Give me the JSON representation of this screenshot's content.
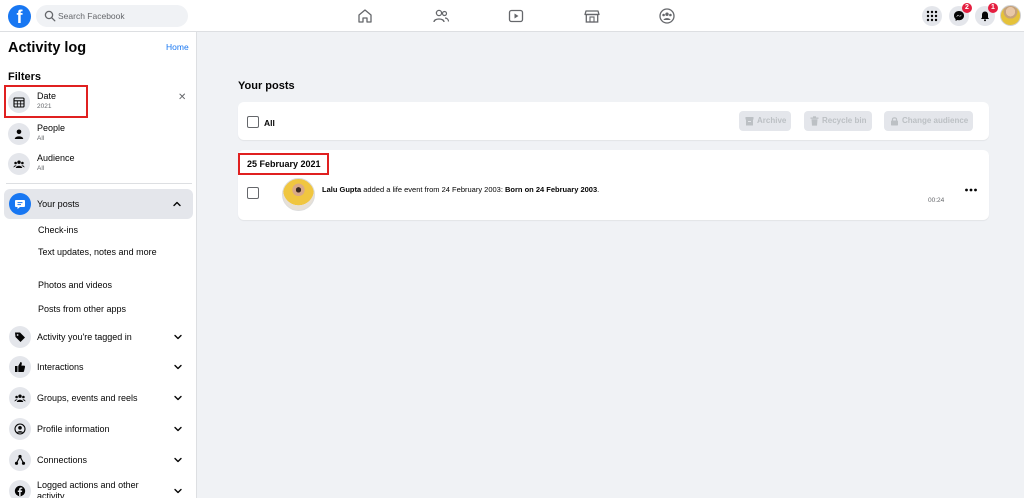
{
  "topbar": {
    "logo_letter": "f",
    "search_placeholder": "Search Facebook",
    "nav_icons": [
      "home-icon",
      "friends-icon",
      "watch-icon",
      "marketplace-icon",
      "groups-icon"
    ],
    "messenger_badge": "2",
    "notifications_badge": "1",
    "accent_color": "#1877f2",
    "badge_color": "#e41e3f"
  },
  "sidebar": {
    "title": "Activity log",
    "home_link": "Home",
    "filters_heading": "Filters",
    "filters": [
      {
        "label": "Date",
        "value": "2021",
        "icon": "calendar-icon"
      },
      {
        "label": "People",
        "value": "All",
        "icon": "person-icon"
      },
      {
        "label": "Audience",
        "value": "All",
        "icon": "audience-icon"
      }
    ],
    "active_category": "Your posts",
    "subcategories": [
      "Check-ins",
      "Text updates, notes and more",
      "Photos and videos",
      "Posts from other apps"
    ],
    "categories": [
      {
        "label": "Activity you're tagged in",
        "icon": "tag-icon"
      },
      {
        "label": "Interactions",
        "icon": "thumbs-up-icon"
      },
      {
        "label": "Groups, events and reels",
        "icon": "groups-icon"
      },
      {
        "label": "Profile information",
        "icon": "profile-icon"
      },
      {
        "label": "Connections",
        "icon": "connections-icon"
      },
      {
        "label": "Logged actions and other activity",
        "icon": "facebook-icon"
      }
    ]
  },
  "main": {
    "heading": "Your posts",
    "select_all_label": "All",
    "actions": [
      "Archive",
      "Recycle bin",
      "Change audience"
    ],
    "date_group": "25 February 2021",
    "post": {
      "author": "Lalu Gupta",
      "text": " added a life event from 24 February 2003: ",
      "event": "Born on 24 February 2003",
      "end": ".",
      "time": "00:24"
    },
    "highlight_color": "#e02020"
  }
}
